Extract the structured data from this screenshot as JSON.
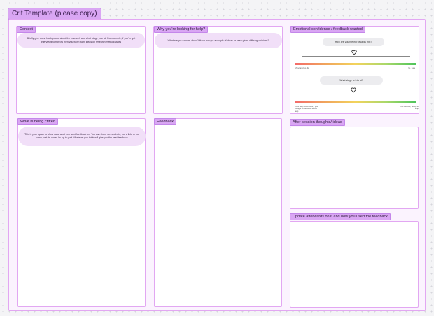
{
  "template_title": "Crit Template (please copy)",
  "sections": {
    "context": {
      "label": "Context",
      "hint": "Briefly give some background about the research and what stage your at. For example, if you've got interviews tomorrow then you won't want ideas on research method/styles"
    },
    "why_help": {
      "label": "Why you're looking for help?",
      "hint": "What are you unsure about? Have you got a couple of ideas or been given differing opinions?"
    },
    "emotional": {
      "label": "Emotional  confidence / feedback wanted",
      "q1": "How are you feeling towards this?",
      "q1_left": "Ah scared yo life",
      "q1_right": "Yo, sure",
      "q2": "What stage is this at?",
      "q2_left": "It's a very rough idea, I just thought a feedback would help",
      "q2_right": "It's finished, ready to ship"
    },
    "being_critted": {
      "label": "What is being critted",
      "hint": "This is your space to show case what you want feedback on. You can share screenshots, put a link, or put some post-its down. Its up to you! Whatever you think will give you the best feedback"
    },
    "feedback": {
      "label": "Feedback"
    },
    "after_session": {
      "label": "After session thoughts/ ideas"
    },
    "update": {
      "label": "Update afterwards on if and how you used the feedback"
    }
  },
  "colors": {
    "tag_fill": "#d9a6f3",
    "board_border": "#e2a7f2",
    "bubble_fill": "#f1dff8"
  }
}
